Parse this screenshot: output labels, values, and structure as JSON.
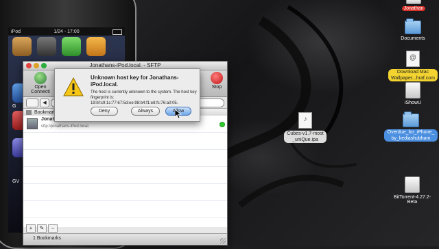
{
  "iphone": {
    "status_left": "iPod",
    "status_time": "1/24 - 17:00",
    "label_g": "G",
    "label_gv": "GV"
  },
  "window": {
    "title": "Jonathans-iPod.local. - SFTP",
    "toolbar": {
      "open_connection": "Open Connecti",
      "stop": "Stop"
    },
    "bookmarks_header": "Bookmark",
    "bookmark": {
      "name": "Jonathans-iPod.local.",
      "url": "sftp://jonathans-iPod.local."
    },
    "footer": "1 Bookmarks",
    "footer_buttons": [
      "+",
      "✎",
      "−"
    ]
  },
  "dialog": {
    "title": "Unknown host key for Jonathans-iPod.local.",
    "message": "The host is currently unknown to the system. The host key fingerprint is: 19:bf:c9:1c:77:67:5d:ee:98:b4:f1:e8:fc:76:a0:05.",
    "deny": "Deny",
    "always": "Always",
    "allow": "Allow"
  },
  "desktop": {
    "jonathan": "Jonathan",
    "documents": "Documents",
    "download": "Download Mac Wallpaper...hraf.com",
    "ishowu": "iShowU",
    "overdue": "Overdue_for_iPhone_by_kediashubham",
    "cubes": "Cubes-v1.7-most_uniQue.ipa",
    "bittorrent": "BitTorrent-4.27.2-Beta"
  },
  "colors": {
    "allow_button": "#6ea7e8",
    "folder": "#5b9ad8",
    "label_red": "#d9332b",
    "label_yellow": "#f2d330",
    "label_blue": "#4b8fe0"
  }
}
